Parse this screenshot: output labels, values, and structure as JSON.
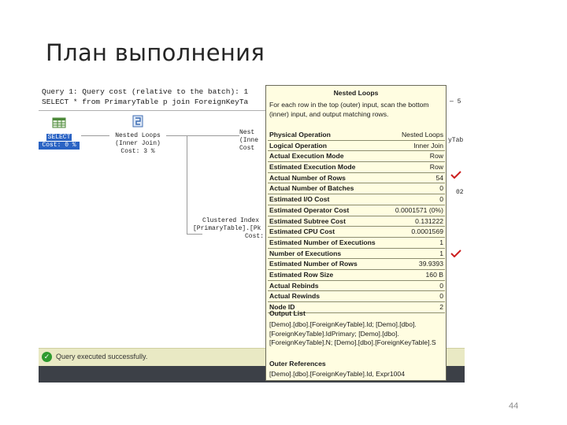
{
  "slide": {
    "title": "План выполнения",
    "page_number": "44"
  },
  "query": {
    "line1": "Query 1: Query cost (relative to the batch): 1",
    "line2": "SELECT * from PrimaryTable p join ForeignKeyTa"
  },
  "plan": {
    "select_node": {
      "label": "SELECT",
      "cost": "Cost: 0 %"
    },
    "nested_loops_node": {
      "label": "Nested Loops",
      "sub": "(Inner Join)",
      "cost": "Cost: 3 %"
    },
    "nested_loops_right": {
      "label": "Nest",
      "sub": "(Inne",
      "cost": "Cost"
    },
    "clustered_index_node": {
      "label": "Clustered Index",
      "sub": "[PrimaryTable].[Pk",
      "cost": "Cost:"
    }
  },
  "side_text": {
    "right_top": "yTab",
    "dash5": "— 5",
    "tail": "02"
  },
  "tooltip": {
    "title": "Nested Loops",
    "description": "For each row in the top (outer) input, scan the bottom (inner) input, and output matching rows.",
    "properties": [
      {
        "name": "Physical Operation",
        "value": "Nested Loops"
      },
      {
        "name": "Logical Operation",
        "value": "Inner Join"
      },
      {
        "name": "Actual Execution Mode",
        "value": "Row"
      },
      {
        "name": "Estimated Execution Mode",
        "value": "Row"
      },
      {
        "name": "Actual Number of Rows",
        "value": "54"
      },
      {
        "name": "Actual Number of Batches",
        "value": "0"
      },
      {
        "name": "Estimated I/O Cost",
        "value": "0"
      },
      {
        "name": "Estimated Operator Cost",
        "value": "0.0001571 (0%)"
      },
      {
        "name": "Estimated Subtree Cost",
        "value": "0.131222"
      },
      {
        "name": "Estimated CPU Cost",
        "value": "0.0001569"
      },
      {
        "name": "Estimated Number of Executions",
        "value": "1"
      },
      {
        "name": "Number of Executions",
        "value": "1"
      },
      {
        "name": "Estimated Number of Rows",
        "value": "39.9393"
      },
      {
        "name": "Estimated Row Size",
        "value": "160 B"
      },
      {
        "name": "Actual Rebinds",
        "value": "0"
      },
      {
        "name": "Actual Rewinds",
        "value": "0"
      },
      {
        "name": "Node ID",
        "value": "2"
      }
    ],
    "output_list_header": "Output List",
    "output_list": "[Demo].[dbo].[ForeignKeyTable].Id; [Demo].[dbo].[ForeignKeyTable].IdPrimary; [Demo].[dbo].[ForeignKeyTable].N; [Demo].[dbo].[ForeignKeyTable].S",
    "outer_references_header": "Outer References",
    "outer_references": "[Demo].[dbo].[ForeignKeyTable].Id, Expr1004"
  },
  "status": {
    "text": "Query executed successfully."
  },
  "colors": {
    "check_mark": "#cc1f1f",
    "status_bar": "#e9e9c4",
    "tooltip_bg": "#fffde1"
  }
}
